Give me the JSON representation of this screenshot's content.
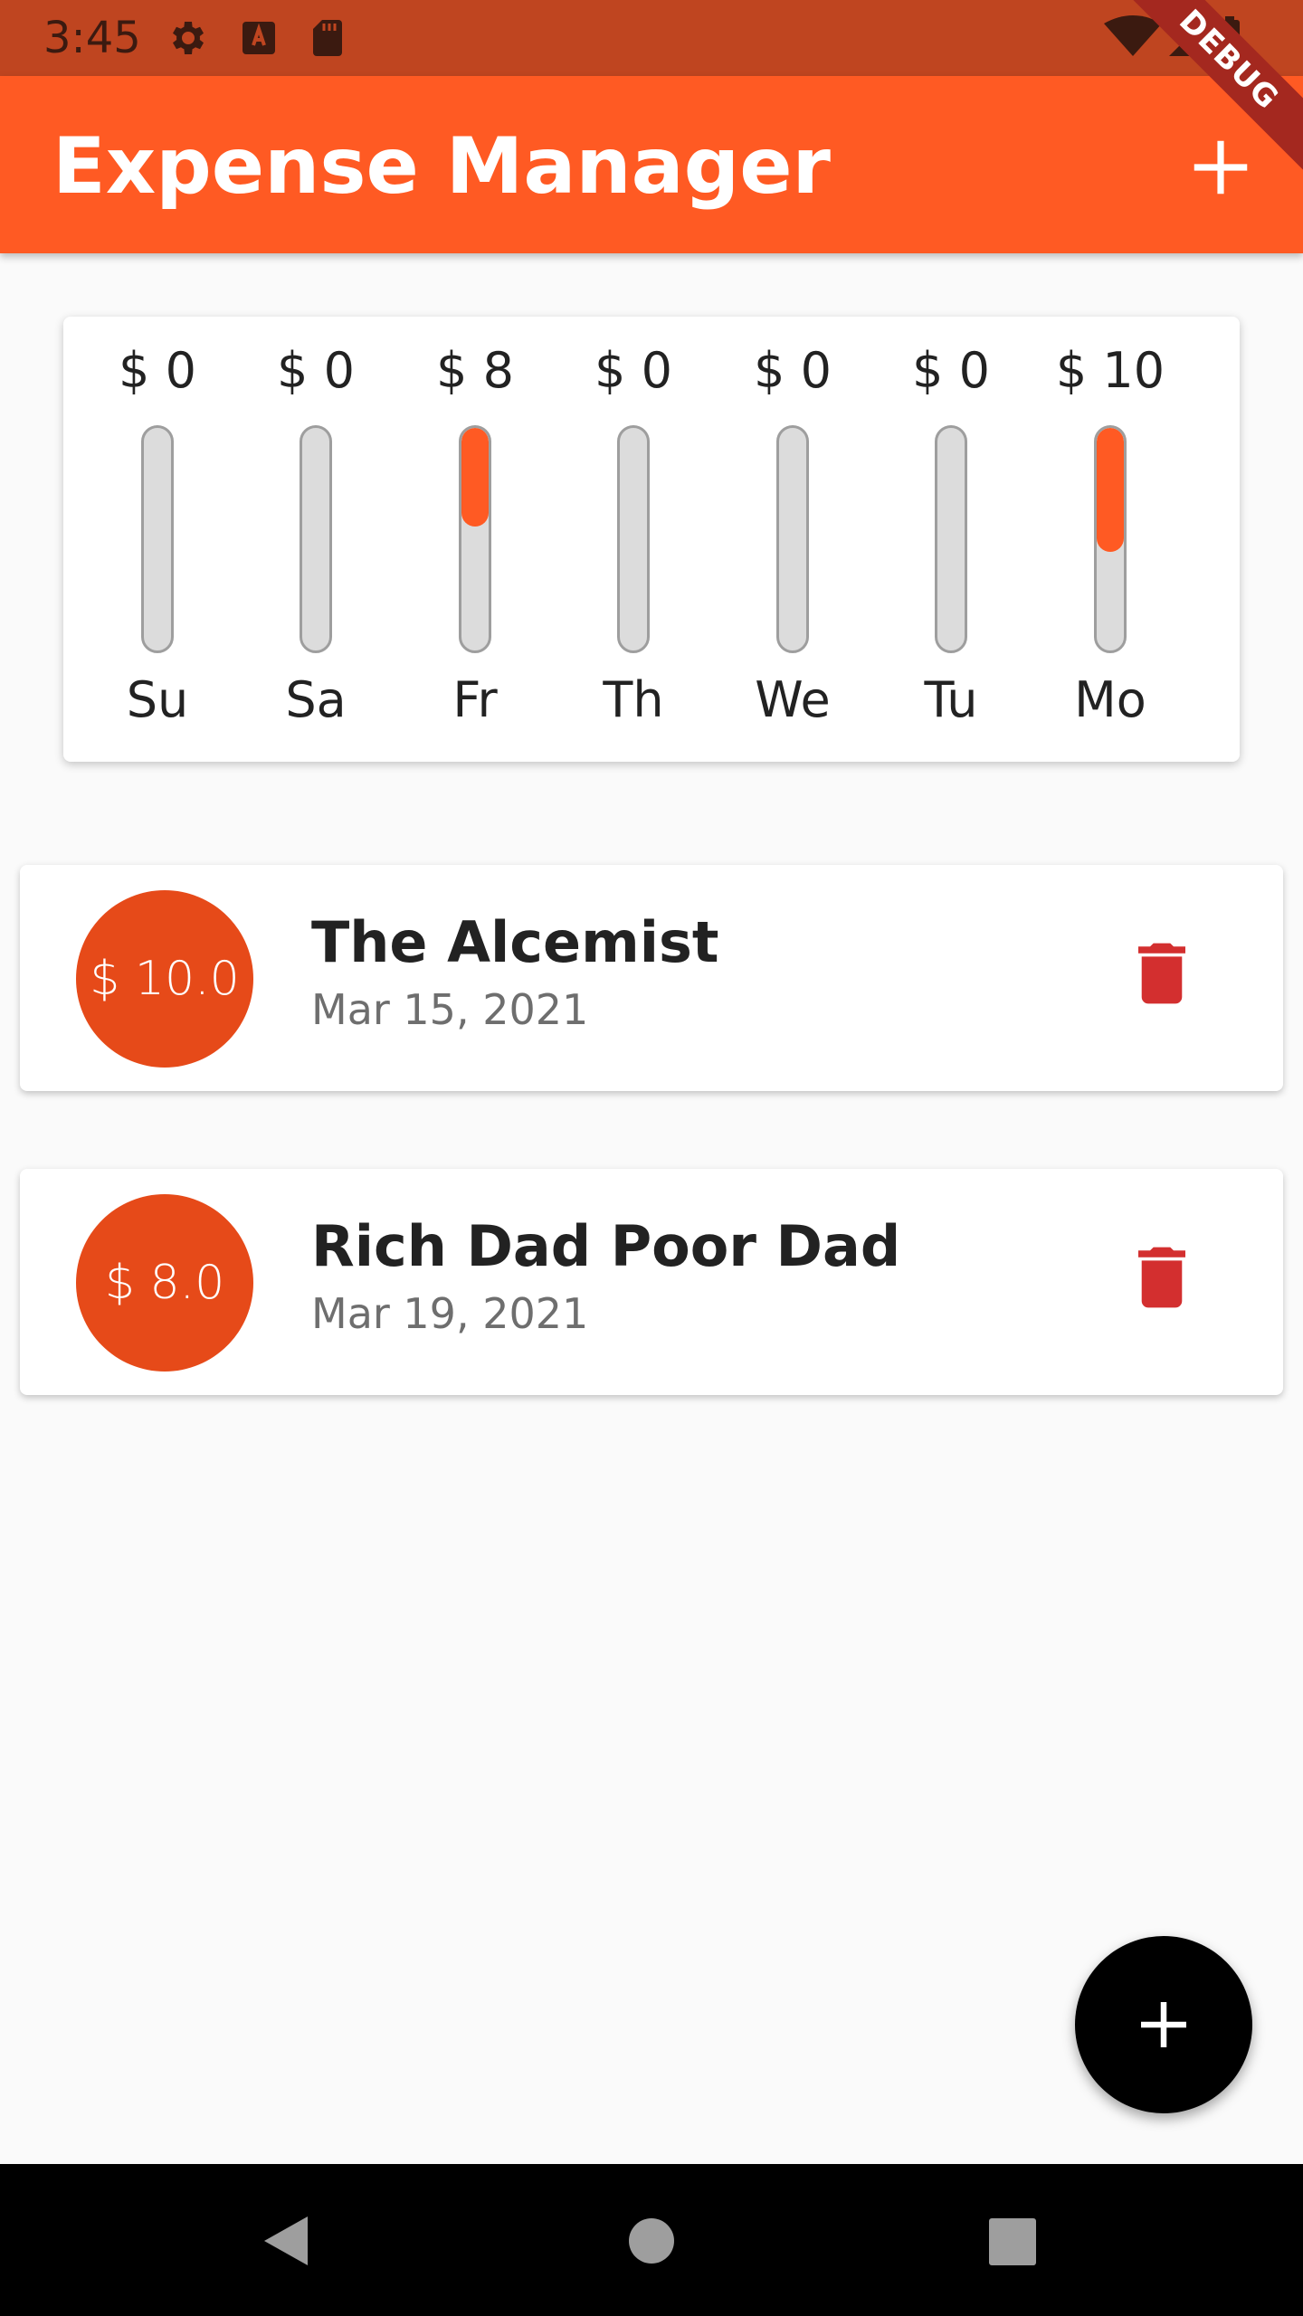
{
  "status_bar": {
    "time": "3:45",
    "icons": [
      "gear-icon",
      "text-a-icon",
      "sd-card-icon",
      "wifi-icon",
      "signal-icon",
      "battery-icon"
    ]
  },
  "app_bar": {
    "title": "Expense Manager",
    "debug_label": "DEBUG",
    "add_icon": "plus-icon",
    "color": "#ff5a23"
  },
  "chart": {
    "bars": [
      {
        "day": "Su",
        "amount": "$ 0",
        "fraction": 0
      },
      {
        "day": "Sa",
        "amount": "$ 0",
        "fraction": 0
      },
      {
        "day": "Fr",
        "amount": "$ 8",
        "fraction": 0.444
      },
      {
        "day": "Th",
        "amount": "$ 0",
        "fraction": 0
      },
      {
        "day": "We",
        "amount": "$ 0",
        "fraction": 0
      },
      {
        "day": "Tu",
        "amount": "$ 0",
        "fraction": 0
      },
      {
        "day": "Mo",
        "amount": "$ 10",
        "fraction": 0.556
      }
    ],
    "fill_color": "#ff5a23",
    "track_color": "#dcdcdc"
  },
  "transactions": [
    {
      "amount": "$ 10.0",
      "title": "The Alcemist",
      "date": "Mar 15, 2021",
      "delete_icon": "trash-icon"
    },
    {
      "amount": "$ 8.0",
      "title": "Rich Dad Poor Dad",
      "date": "Mar 19, 2021",
      "delete_icon": "trash-icon"
    }
  ],
  "colors": {
    "avatar": "#e64a19",
    "delete": "#d32f2f",
    "fab": "#000000"
  },
  "fab": {
    "icon": "plus-icon"
  },
  "nav_bar": {
    "icons": [
      "back-triangle-icon",
      "home-circle-icon",
      "recents-square-icon"
    ]
  }
}
